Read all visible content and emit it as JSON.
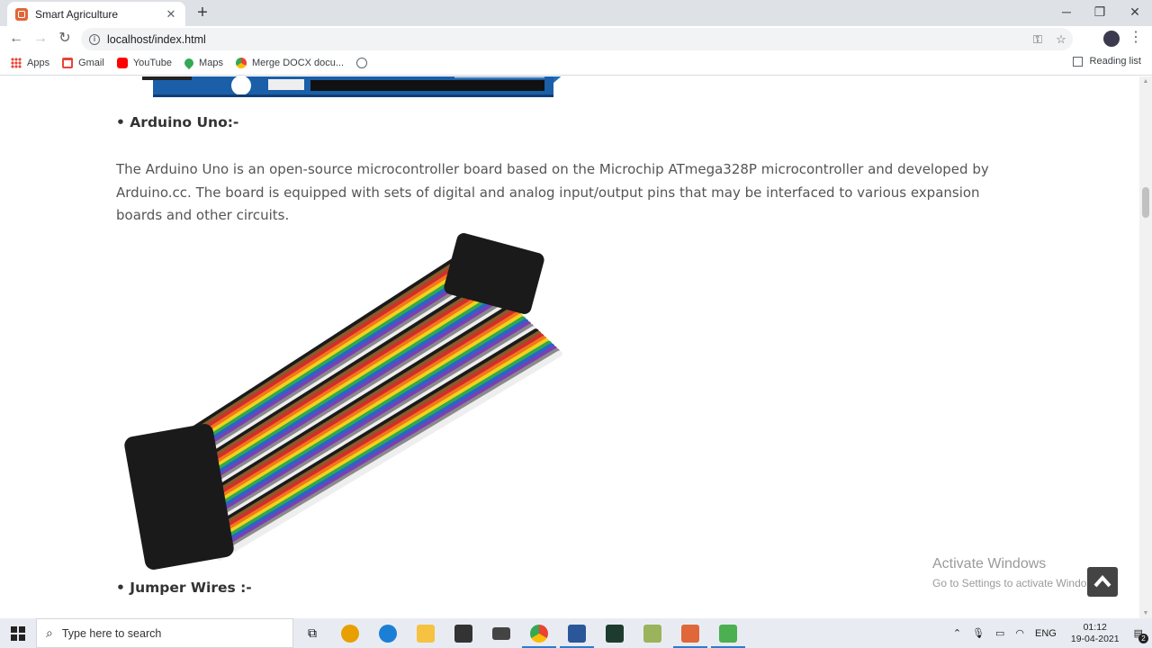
{
  "browser": {
    "tab_title": "Smart Agriculture",
    "url": "localhost/index.html",
    "bookmarks": [
      "Apps",
      "Gmail",
      "YouTube",
      "Maps",
      "Merge DOCX docu..."
    ],
    "reading_list": "Reading list"
  },
  "content": {
    "heading_arduino": "• Arduino Uno:-",
    "para_arduino": "The Arduino Uno is an open-source microcontroller board based on the Microchip ATmega328P microcontroller and developed by Arduino.cc. The board is equipped with sets of digital and analog input/output pins that may be interfaced to various expansion boards and other circuits.",
    "heading_wires": "• Jumper Wires :-"
  },
  "watermark": {
    "title": "Activate Windows",
    "subtitle": "Go to Settings to activate Windo"
  },
  "taskbar": {
    "search_placeholder": "Type here to search",
    "language": "ENG",
    "time": "01:12",
    "date": "19-04-2021",
    "notification_count": "2"
  },
  "colors": {
    "accent": "#2b7cd3",
    "favicon": "#e0673a"
  }
}
